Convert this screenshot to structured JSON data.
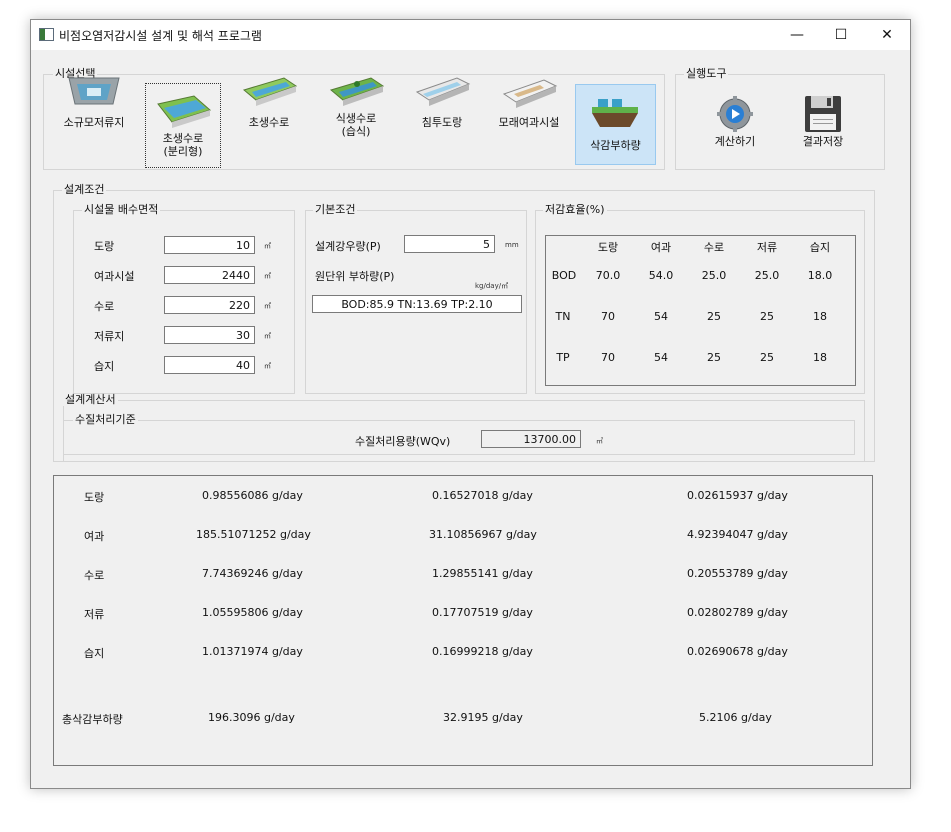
{
  "window": {
    "title": "비점오염저감시설 설계 및 해석 프로그램",
    "minimize": "—",
    "maximize": "☐",
    "close": "✕"
  },
  "facility_group": {
    "title": "시설선택",
    "items": [
      {
        "label": "소규모저류지",
        "icon": "small-reservoir-icon"
      },
      {
        "label": "초생수로\n(분리형)",
        "icon": "grass-channel-separated-icon"
      },
      {
        "label": "초생수로",
        "icon": "grass-channel-icon"
      },
      {
        "label": "식생수로\n(습식)",
        "icon": "vegetated-channel-wet-icon"
      },
      {
        "label": "침투도랑",
        "icon": "infiltration-trench-icon"
      },
      {
        "label": "모래여과시설",
        "icon": "sand-filter-icon"
      },
      {
        "label": "삭감부하량",
        "icon": "load-reduction-icon"
      }
    ]
  },
  "run_tools": {
    "title": "실행도구",
    "calculate": {
      "label": "계산하기",
      "icon": "gear-icon"
    },
    "save": {
      "label": "결과저장",
      "icon": "floppy-disk-icon"
    }
  },
  "design_conditions": {
    "title": "설계조건",
    "catchment": {
      "title": "시설물 배수면적",
      "rows": [
        {
          "label": "도랑",
          "value": "10",
          "unit": "㎡"
        },
        {
          "label": "여과시설",
          "value": "2440",
          "unit": "㎡"
        },
        {
          "label": "수로",
          "value": "220",
          "unit": "㎡"
        },
        {
          "label": "저류지",
          "value": "30",
          "unit": "㎡"
        },
        {
          "label": "습지",
          "value": "40",
          "unit": "㎡"
        }
      ]
    },
    "basic": {
      "title": "기본조건",
      "rainfall_label": "설계강우량(P)",
      "rainfall_value": "5",
      "rainfall_unit": "mm",
      "unit_load_label": "원단위 부하량(P)",
      "unit_load_unit": "kg/day/㎡",
      "unit_load_value": "BOD:85.9 TN:13.69 TP:2.10"
    },
    "efficiency": {
      "title": "저감효율(%)",
      "columns": [
        "도랑",
        "여과",
        "수로",
        "저류",
        "습지"
      ],
      "rows": [
        {
          "label": "BOD",
          "values": [
            "70.0",
            "54.0",
            "25.0",
            "25.0",
            "18.0"
          ]
        },
        {
          "label": "TN",
          "values": [
            "70",
            "54",
            "25",
            "25",
            "18"
          ]
        },
        {
          "label": "TP",
          "values": [
            "70",
            "54",
            "25",
            "25",
            "18"
          ]
        }
      ]
    }
  },
  "calc_sheet": {
    "title": "설계계산서",
    "wq_title": "수질처리기준",
    "wqv_label": "수질처리용량(WQv)",
    "wqv_value": "13700.00",
    "wqv_unit": "㎥"
  },
  "results": {
    "rows": [
      {
        "label": "도랑",
        "bod": "0.98556086 g/day",
        "tn": "0.16527018 g/day",
        "tp": "0.02615937 g/day"
      },
      {
        "label": "여과",
        "bod": "185.51071252 g/day",
        "tn": "31.10856967 g/day",
        "tp": "4.92394047 g/day"
      },
      {
        "label": "수로",
        "bod": "7.74369246 g/day",
        "tn": "1.29855141 g/day",
        "tp": "0.20553789 g/day"
      },
      {
        "label": "저류",
        "bod": "1.05595806 g/day",
        "tn": "0.17707519 g/day",
        "tp": "0.02802789 g/day"
      },
      {
        "label": "습지",
        "bod": "1.01371974 g/day",
        "tn": "0.16999218 g/day",
        "tp": "0.02690678 g/day"
      }
    ],
    "total": {
      "label": "총삭감부하량",
      "bod": "196.3096 g/day",
      "tn": "32.9195 g/day",
      "tp": "5.2106 g/day"
    }
  }
}
